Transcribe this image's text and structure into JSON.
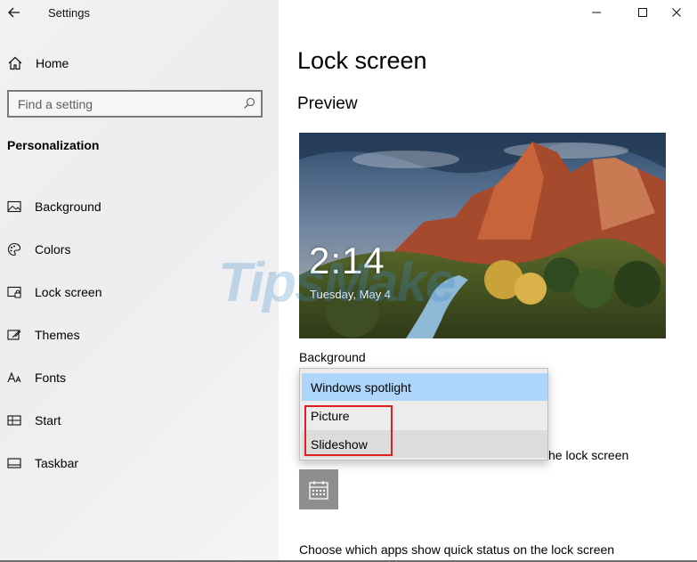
{
  "window": {
    "title": "Settings",
    "controls": [
      "minimize",
      "maximize",
      "close"
    ]
  },
  "sidebar": {
    "home_label": "Home",
    "search_placeholder": "Find a setting",
    "section_title": "Personalization",
    "items": [
      {
        "label": "Background",
        "icon": "picture-icon"
      },
      {
        "label": "Colors",
        "icon": "palette-icon"
      },
      {
        "label": "Lock screen",
        "icon": "lock-screen-icon"
      },
      {
        "label": "Themes",
        "icon": "themes-icon"
      },
      {
        "label": "Fonts",
        "icon": "fonts-icon"
      },
      {
        "label": "Start",
        "icon": "start-icon"
      },
      {
        "label": "Taskbar",
        "icon": "taskbar-icon"
      }
    ]
  },
  "main": {
    "page_title": "Lock screen",
    "preview_title": "Preview",
    "preview": {
      "time": "2:14",
      "date": "Tuesday, May 4"
    },
    "background_label": "Background",
    "background_options": [
      "Windows spotlight",
      "Picture",
      "Slideshow"
    ],
    "selected_option": "Windows spotlight",
    "highlighted_options": [
      "Picture",
      "Slideshow"
    ],
    "partial_text": "he lock screen",
    "quick_status_label": "Choose which apps show quick status on the lock screen"
  },
  "watermark": "TipsMake",
  "colors": {
    "selection": "#aed6fb",
    "highlight_box": "#e02020",
    "sidebar_bg": "#f2f2f2",
    "tile": "#8e8e8e"
  }
}
